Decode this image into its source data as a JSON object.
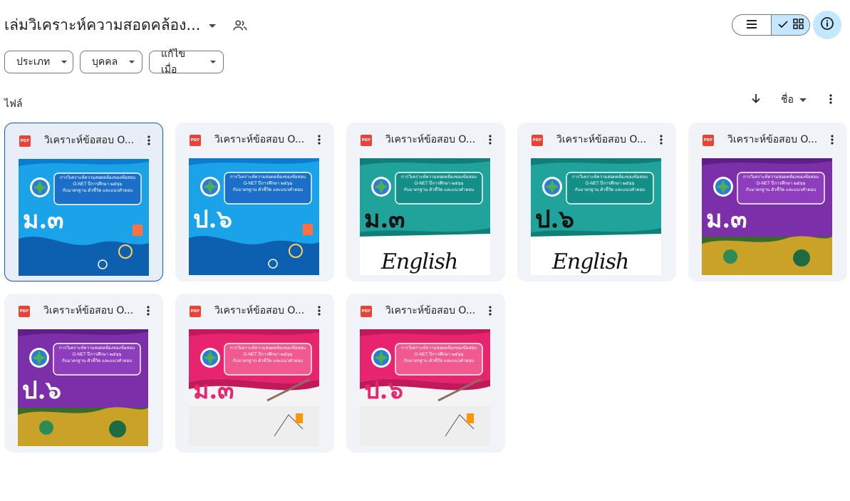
{
  "header": {
    "title": "เล่มวิเคราะห์ความสอดคล้อง...",
    "share_icon": "people-icon",
    "list_view_icon": "list-icon",
    "grid_view_icon": "grid-icon",
    "info_icon": "info-icon"
  },
  "filters": [
    {
      "label": "ประเภท"
    },
    {
      "label": "บุคคล"
    },
    {
      "label": "แก้ไขเมื่อ"
    }
  ],
  "files_section": {
    "label": "ไฟล์",
    "sort_label": "ชื่อ"
  },
  "colors": {
    "accent": "#0b57d0",
    "selected_bg": "#c2e7ff",
    "card_bg": "#f0f4f9",
    "pdf_red": "#ea4335"
  },
  "cover_text": {
    "line1": "การวิเคราะห์ความสอดคล้องของข้อสอบ",
    "line2": "O-NET ปีการศึกษา ๒๕๖๖",
    "line3": "กับมาตรฐาน ตัวชี้วัด และแนวคำตอบ",
    "english": "English"
  },
  "files": [
    {
      "name": "วิเคราะห์ข้อสอบ O...",
      "grade": "ม.๓",
      "theme": "blue",
      "selected": true
    },
    {
      "name": "วิเคราะห์ข้อสอบ O...",
      "grade": "ป.๖",
      "theme": "blue",
      "selected": false
    },
    {
      "name": "วิเคราะห์ข้อสอบ O...",
      "grade": "ม.๓",
      "theme": "teal",
      "selected": false
    },
    {
      "name": "วิเคราะห์ข้อสอบ O...",
      "grade": "ป.๖",
      "theme": "teal",
      "selected": false
    },
    {
      "name": "วิเคราะห์ข้อสอบ O...",
      "grade": "ม.๓",
      "theme": "purple",
      "selected": false
    },
    {
      "name": "วิเคราะห์ข้อสอบ O...",
      "grade": "ป.๖",
      "theme": "purple",
      "selected": false
    },
    {
      "name": "วิเคราะห์ข้อสอบ O...",
      "grade": "ม.๓",
      "theme": "pink",
      "selected": false
    },
    {
      "name": "วิเคราะห์ข้อสอบ O...",
      "grade": "ป.๖",
      "theme": "pink",
      "selected": false
    }
  ]
}
